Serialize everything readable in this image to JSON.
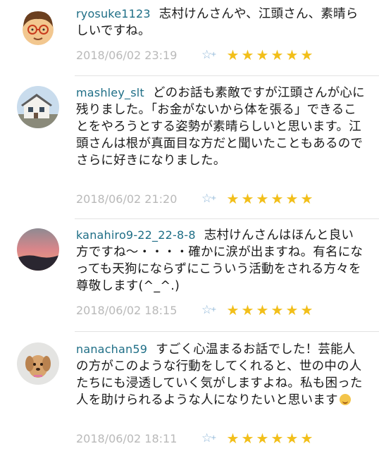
{
  "comments": [
    {
      "username": "ryosuke1123",
      "text": "志村けんさんや、江頭さん、素晴らしいですね。",
      "date": "2018/06/02 23:19",
      "rating": 6
    },
    {
      "username": "mashley_slt",
      "text": "どのお話も素敵ですが江頭さんが心に残りました。「お金がないから体を張る」できることをやろうとする姿勢が素晴らしいと思います。江頭さんは根が真面目な方だと聞いたこともあるのでさらに好きになりました。",
      "date": "2018/06/02 21:20",
      "rating": 6
    },
    {
      "username": "kanahiro9-22_22-8-8",
      "text": "志村けんさんはほんと良い方ですね〜・・・・確かに涙が出ますね。有名になっても天狗にならずにこういう活動をされる方々を尊敬します(^_^.)",
      "date": "2018/06/02 18:15",
      "rating": 6
    },
    {
      "username": "nanachan59",
      "text": "すごく心温まるお話でした！芸能人の方がこのような行動をしてくれると、世の中の人たちにも浸透していく気がしますよね。私も困った人を助けられるような人になりたいと思います",
      "date": "2018/06/02 18:11",
      "rating": 6
    }
  ],
  "icons": {
    "favorite": "star-plus-icon",
    "rating": "star-icon",
    "emoji": "smiling-face-icon"
  },
  "colors": {
    "username": "#1e6e86",
    "date": "#b9b9b9",
    "star": "#f2bf1a",
    "fav": "#8fb7d8"
  }
}
